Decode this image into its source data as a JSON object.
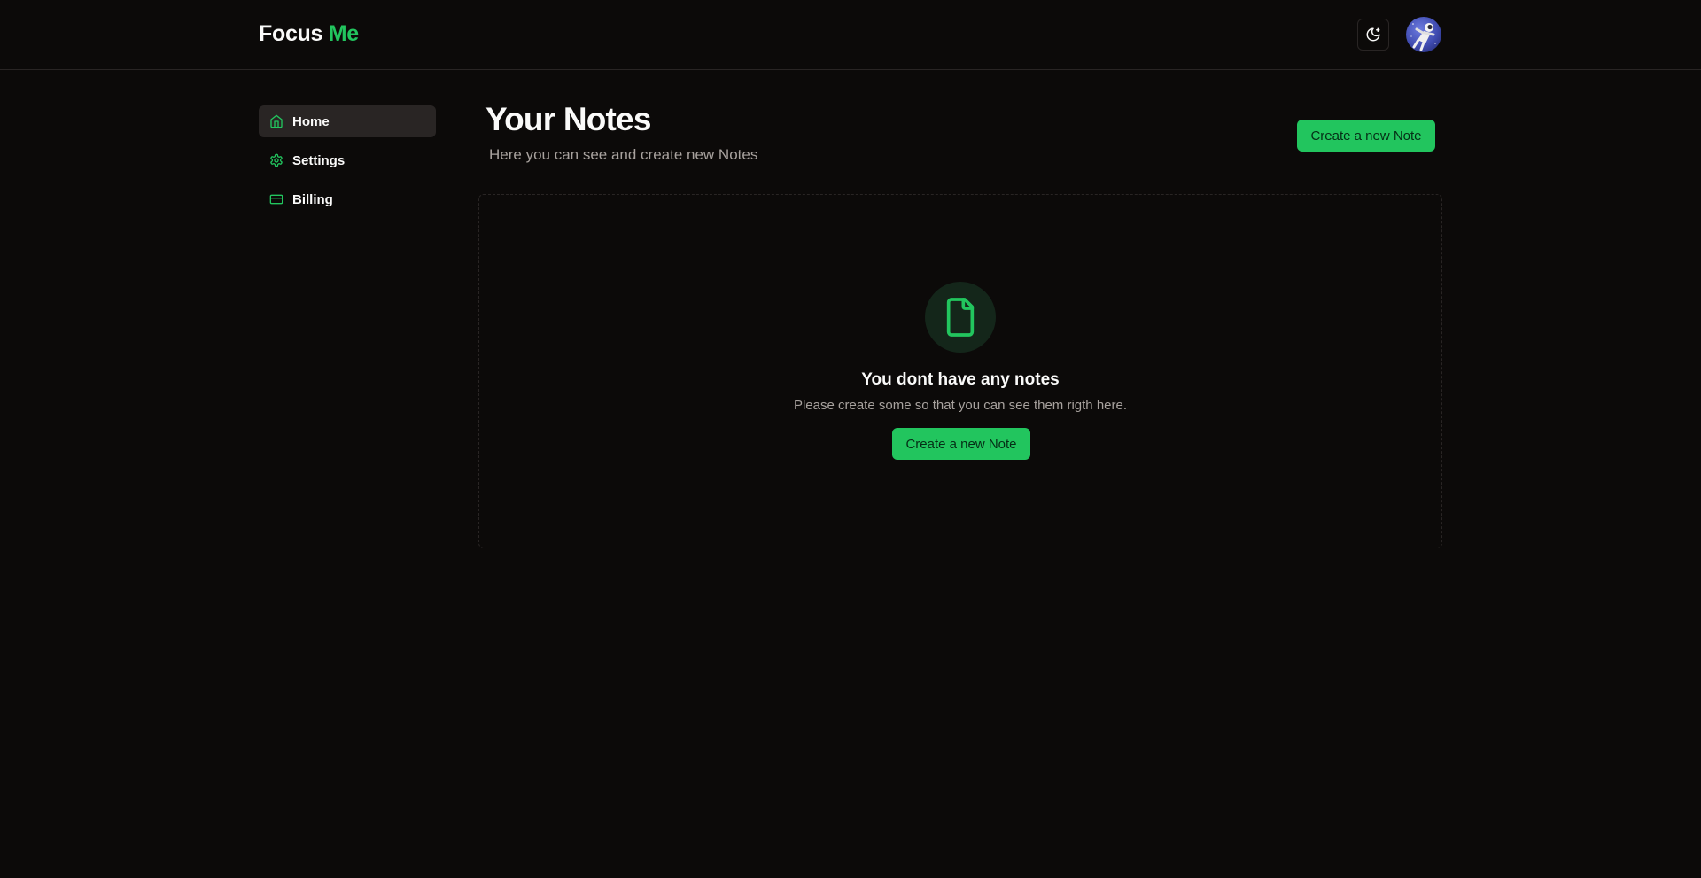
{
  "brand": {
    "name": "Focus",
    "accent": "Me",
    "accent_color": "#22c55e"
  },
  "header": {
    "theme_icon": "moon-icon",
    "avatar_icon": "astronaut-avatar"
  },
  "sidebar": {
    "items": [
      {
        "label": "Home",
        "icon": "home-icon",
        "active": true
      },
      {
        "label": "Settings",
        "icon": "gear-icon",
        "active": false
      },
      {
        "label": "Billing",
        "icon": "credit-card-icon",
        "active": false
      }
    ]
  },
  "main": {
    "title": "Your Notes",
    "subtitle": "Here you can see and create new Notes",
    "create_button": "Create a new Note"
  },
  "empty_state": {
    "icon": "file-icon",
    "title": "You dont have any notes",
    "description": "Please create some so that you can see them rigth here.",
    "button": "Create a new Note"
  },
  "colors": {
    "background": "#0c0a09",
    "border": "#292524",
    "primary": "#22c55e",
    "muted_text": "#a8a29e"
  }
}
